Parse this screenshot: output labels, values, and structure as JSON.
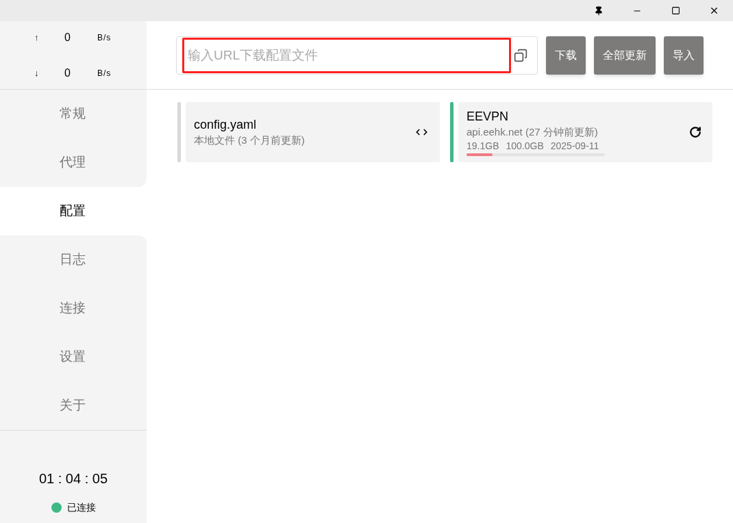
{
  "traffic": [
    {
      "arrow": "↑",
      "value": "0",
      "unit": "B/s"
    },
    {
      "arrow": "↓",
      "value": "0",
      "unit": "B/s"
    }
  ],
  "nav": [
    {
      "label": "常规",
      "selected": false
    },
    {
      "label": "代理",
      "selected": false
    },
    {
      "label": "配置",
      "selected": true
    },
    {
      "label": "日志",
      "selected": false
    },
    {
      "label": "连接",
      "selected": false
    },
    {
      "label": "设置",
      "selected": false
    },
    {
      "label": "关于",
      "selected": false
    }
  ],
  "uptime": "01 : 04 : 05",
  "status": {
    "label": "已连接",
    "color": "#3fb883"
  },
  "url_field": {
    "placeholder": "输入URL下载配置文件",
    "highlighted": true
  },
  "buttons": [
    "下载",
    "全部更新",
    "导入"
  ],
  "profiles": [
    {
      "kind": "local",
      "name": "config.yaml",
      "detail": "本地文件 (3 个月前更新)",
      "selected": false
    },
    {
      "kind": "remote",
      "name": "EEVPN",
      "detail": "api.eehk.net (27 分钟前更新)",
      "used": "19.1GB",
      "total": "100.0GB",
      "expires": "2025-09-11",
      "level": 0.19,
      "selected": true
    }
  ]
}
